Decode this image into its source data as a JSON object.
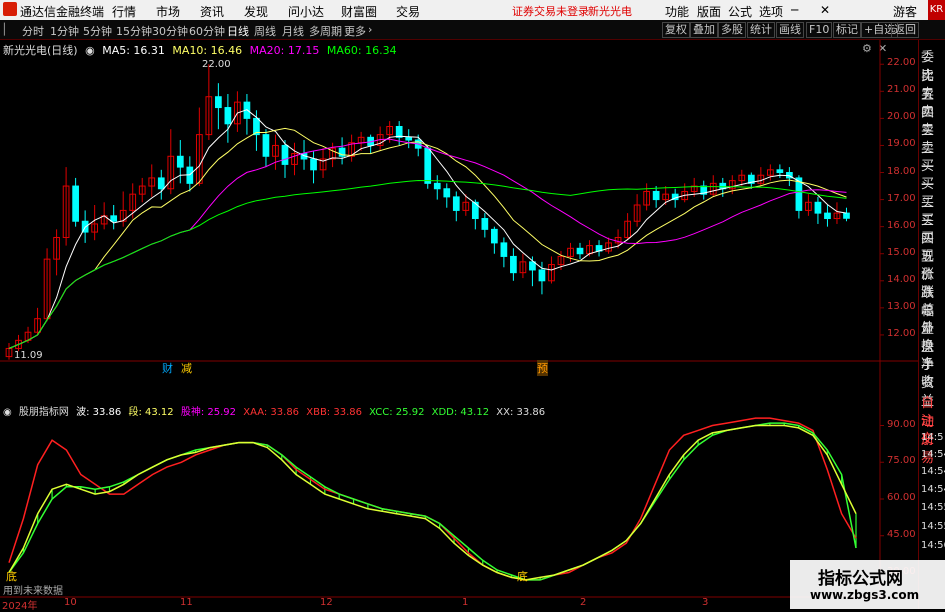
{
  "titlebar": {
    "app_name": "通达信金融终端",
    "menus": [
      "行情",
      "市场",
      "资讯",
      "发现",
      "问小达",
      "财富圈",
      "交易"
    ],
    "warning": "证券交易未登录",
    "stock": "新光光电",
    "right_menus": [
      "功能",
      "版面",
      "公式",
      "选项"
    ],
    "guest": "游客",
    "tag": "KR"
  },
  "toolbar": {
    "periods": [
      "分时",
      "1分钟",
      "5分钟",
      "15分钟",
      "30分钟",
      "60分钟",
      "日线",
      "周线",
      "月线",
      "多周期",
      "更多"
    ],
    "active_period": "日线",
    "right_buttons": [
      "复权",
      "叠加",
      "多股",
      "统计",
      "画线",
      "F10",
      "标记",
      "+自选",
      "返回"
    ]
  },
  "main_legend": {
    "stock_label": "新光光电(日线)",
    "ma5": "MA5: 16.31",
    "ma10": "MA10: 16.46",
    "ma20": "MA20: 17.15",
    "ma60": "MA60: 16.34"
  },
  "price_axis": [
    "22.00",
    "21.00",
    "20.00",
    "19.00",
    "18.00",
    "17.00",
    "16.00",
    "15.00",
    "14.00",
    "13.00",
    "12.00"
  ],
  "annotations": {
    "high": "22.00",
    "low": "11.09",
    "cai": "财",
    "jian": "减",
    "yu": "预"
  },
  "indicator_legend": {
    "name": "股朋指标网",
    "bo": "波: 33.86",
    "duan": "段: 43.12",
    "gushen": "股神: 25.92",
    "xaa": "XAA: 33.86",
    "xbb": "XBB: 33.86",
    "xcc": "XCC: 25.92",
    "xdd": "XDD: 43.12",
    "xx": "XX: 33.86"
  },
  "indicator_axis": [
    "90.00",
    "75.00",
    "60.00",
    "45.00",
    "30.00"
  ],
  "indicator_notes": {
    "di1": "底",
    "di2": "底",
    "future": "用到未来数据"
  },
  "x_axis": [
    "2024年",
    "10",
    "11",
    "12",
    "1",
    "2",
    "3"
  ],
  "right_panel": {
    "items": [
      "委比",
      "卖五",
      "卖四",
      "卖三",
      "卖二",
      "卖一",
      "买一",
      "买二",
      "买三",
      "买四",
      "买五",
      "现价",
      "涨跌",
      "涨幅",
      "总量",
      "外盘",
      "换手",
      "净资",
      "收益",
      "自动",
      "注册",
      "交易"
    ],
    "times": [
      "14:5",
      "14:54",
      "14:54",
      "14:54",
      "14:55",
      "14:55",
      "14:56"
    ]
  },
  "colors": {
    "up": "#e00000",
    "down": "#00ffff",
    "ma5": "#ffffff",
    "ma10": "#ffff66",
    "ma20": "#ff00ff",
    "ma60": "#00ff00"
  },
  "chart_data": {
    "type": "candlestick",
    "price_ylim": [
      11.0,
      22.6
    ],
    "indicator_ylim": [
      20,
      100
    ],
    "candles": [
      [
        11.2,
        11.5,
        11.09,
        11.7
      ],
      [
        11.5,
        11.8,
        11.4,
        12.0
      ],
      [
        11.8,
        12.1,
        11.7,
        12.3
      ],
      [
        12.1,
        12.6,
        12.0,
        13.0
      ],
      [
        12.6,
        14.8,
        12.5,
        15.2
      ],
      [
        14.8,
        15.6,
        14.2,
        15.9
      ],
      [
        15.6,
        17.5,
        15.3,
        18.2
      ],
      [
        17.5,
        16.2,
        16.0,
        17.8
      ],
      [
        16.2,
        15.8,
        15.4,
        16.6
      ],
      [
        15.8,
        16.1,
        15.5,
        16.8
      ],
      [
        16.1,
        16.4,
        15.9,
        16.9
      ],
      [
        16.4,
        16.2,
        15.9,
        16.8
      ],
      [
        16.2,
        16.6,
        16.0,
        17.3
      ],
      [
        16.6,
        17.2,
        16.3,
        17.6
      ],
      [
        17.2,
        17.5,
        16.9,
        17.8
      ],
      [
        17.5,
        17.8,
        17.1,
        18.3
      ],
      [
        17.8,
        17.4,
        17.0,
        18.1
      ],
      [
        17.4,
        18.6,
        17.2,
        19.6
      ],
      [
        18.6,
        18.2,
        17.6,
        19.2
      ],
      [
        18.2,
        17.6,
        17.3,
        18.6
      ],
      [
        17.6,
        19.4,
        17.5,
        20.4
      ],
      [
        19.4,
        20.8,
        19.2,
        22.0
      ],
      [
        20.8,
        20.4,
        19.6,
        21.3
      ],
      [
        20.4,
        19.8,
        19.1,
        20.9
      ],
      [
        19.8,
        20.6,
        19.5,
        21.0
      ],
      [
        20.6,
        20.0,
        19.4,
        20.9
      ],
      [
        20.0,
        19.4,
        18.8,
        20.3
      ],
      [
        19.4,
        18.6,
        18.2,
        19.6
      ],
      [
        18.6,
        19.0,
        18.1,
        19.4
      ],
      [
        19.0,
        18.3,
        17.8,
        19.2
      ],
      [
        18.3,
        18.7,
        17.9,
        19.1
      ],
      [
        18.7,
        18.5,
        18.1,
        19.2
      ],
      [
        18.5,
        18.1,
        17.6,
        18.8
      ],
      [
        18.1,
        18.5,
        17.8,
        18.9
      ],
      [
        18.5,
        18.9,
        18.2,
        19.1
      ],
      [
        18.9,
        18.6,
        18.3,
        19.3
      ],
      [
        18.6,
        19.1,
        18.4,
        19.4
      ],
      [
        19.1,
        19.3,
        18.8,
        19.5
      ],
      [
        19.3,
        19.0,
        18.7,
        19.4
      ],
      [
        19.0,
        19.4,
        18.8,
        19.7
      ],
      [
        19.4,
        19.7,
        19.1,
        19.9
      ],
      [
        19.7,
        19.3,
        19.0,
        19.9
      ],
      [
        19.3,
        19.2,
        18.9,
        19.6
      ],
      [
        19.2,
        18.9,
        18.6,
        19.4
      ],
      [
        18.9,
        17.6,
        17.4,
        19.0
      ],
      [
        17.6,
        17.4,
        17.0,
        17.9
      ],
      [
        17.4,
        17.1,
        16.7,
        17.6
      ],
      [
        17.1,
        16.6,
        16.2,
        17.3
      ],
      [
        16.6,
        16.9,
        16.4,
        17.2
      ],
      [
        16.9,
        16.3,
        15.9,
        17.0
      ],
      [
        16.3,
        15.9,
        15.6,
        16.5
      ],
      [
        15.9,
        15.4,
        15.0,
        16.0
      ],
      [
        15.4,
        14.9,
        14.5,
        15.6
      ],
      [
        14.9,
        14.3,
        14.0,
        15.2
      ],
      [
        14.3,
        14.7,
        14.1,
        15.0
      ],
      [
        14.7,
        14.4,
        13.8,
        14.9
      ],
      [
        14.4,
        14.0,
        13.5,
        14.7
      ],
      [
        14.0,
        14.6,
        13.9,
        14.9
      ],
      [
        14.6,
        14.9,
        14.4,
        15.1
      ],
      [
        14.9,
        15.2,
        14.7,
        15.4
      ],
      [
        15.2,
        15.0,
        14.8,
        15.4
      ],
      [
        15.0,
        15.3,
        14.9,
        15.5
      ],
      [
        15.3,
        15.1,
        14.9,
        15.5
      ],
      [
        15.1,
        15.4,
        15.0,
        15.6
      ],
      [
        15.4,
        15.6,
        15.2,
        15.9
      ],
      [
        15.6,
        16.2,
        15.5,
        16.5
      ],
      [
        16.2,
        16.8,
        16.0,
        17.2
      ],
      [
        16.8,
        17.3,
        16.6,
        17.6
      ],
      [
        17.3,
        17.0,
        16.7,
        17.5
      ],
      [
        17.0,
        17.2,
        16.8,
        17.5
      ],
      [
        17.2,
        17.0,
        16.7,
        17.4
      ],
      [
        17.0,
        17.3,
        16.9,
        17.6
      ],
      [
        17.3,
        17.5,
        17.1,
        17.8
      ],
      [
        17.5,
        17.2,
        17.0,
        17.7
      ],
      [
        17.2,
        17.6,
        17.1,
        17.9
      ],
      [
        17.6,
        17.4,
        17.1,
        17.8
      ],
      [
        17.4,
        17.7,
        17.2,
        17.9
      ],
      [
        17.7,
        17.9,
        17.5,
        18.1
      ],
      [
        17.9,
        17.6,
        17.4,
        18.0
      ],
      [
        17.6,
        17.9,
        17.5,
        18.2
      ],
      [
        17.9,
        18.1,
        17.7,
        18.3
      ],
      [
        18.1,
        18.0,
        17.8,
        18.3
      ],
      [
        18.0,
        17.8,
        17.5,
        18.2
      ],
      [
        17.8,
        16.6,
        16.3,
        17.9
      ],
      [
        16.6,
        16.9,
        16.4,
        17.2
      ],
      [
        16.9,
        16.5,
        16.1,
        17.1
      ],
      [
        16.5,
        16.3,
        16.0,
        16.8
      ],
      [
        16.3,
        16.5,
        16.1,
        16.9
      ],
      [
        16.5,
        16.31,
        16.2,
        16.7
      ]
    ],
    "indicator": {
      "red": [
        34,
        52,
        74,
        84,
        80,
        70,
        66,
        62,
        62,
        66,
        70,
        73,
        75,
        78,
        80,
        82,
        83,
        83,
        82,
        78,
        72,
        68,
        64,
        62,
        60,
        58,
        56,
        55,
        54,
        53,
        50,
        44,
        38,
        33,
        30,
        28,
        27,
        27,
        29,
        30,
        33,
        36,
        38,
        42,
        52,
        66,
        80,
        86,
        88,
        90,
        91,
        92,
        93,
        93,
        92,
        91,
        88,
        72,
        54,
        44
      ],
      "yellow": [
        30,
        40,
        54,
        64,
        66,
        64,
        62,
        63,
        66,
        70,
        73,
        76,
        78,
        79,
        81,
        82,
        83,
        83,
        81,
        76,
        70,
        66,
        62,
        60,
        58,
        56,
        55,
        54,
        53,
        52,
        48,
        42,
        37,
        33,
        30,
        28,
        27,
        28,
        29,
        31,
        33,
        36,
        39,
        43,
        50,
        60,
        70,
        78,
        84,
        87,
        88,
        89,
        90,
        90,
        90,
        89,
        86,
        78,
        66,
        54
      ],
      "green": [
        30,
        38,
        50,
        60,
        65,
        65,
        64,
        65,
        67,
        70,
        73,
        76,
        78,
        80,
        81,
        82,
        83,
        83,
        82,
        78,
        73,
        69,
        65,
        62,
        60,
        58,
        56,
        55,
        54,
        53,
        50,
        45,
        40,
        35,
        31,
        29,
        27,
        27,
        29,
        31,
        33,
        36,
        39,
        43,
        50,
        59,
        68,
        76,
        82,
        86,
        88,
        89,
        90,
        91,
        91,
        90,
        87,
        80,
        70,
        40
      ]
    }
  }
}
